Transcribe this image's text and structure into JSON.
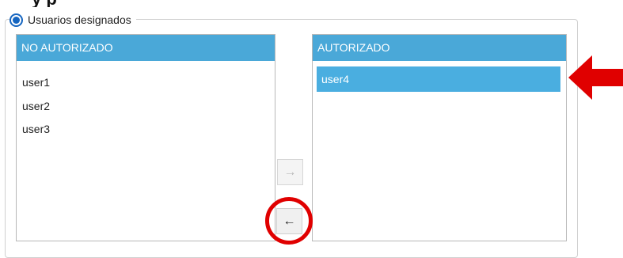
{
  "top_text": "y                         p",
  "group": {
    "radio_label": "Usuarios designados"
  },
  "lists": {
    "left": {
      "header": "NO AUTORIZADO",
      "items": [
        "user1",
        "user2",
        "user3"
      ]
    },
    "right": {
      "header": "AUTORIZADO",
      "items": [
        "user4"
      ],
      "selected_index": 0
    }
  },
  "buttons": {
    "move_right": "→",
    "move_left": "←"
  },
  "colors": {
    "header_blue": "#4aa8d8",
    "selected_blue": "#4aaee0",
    "annotation_red": "#e00000",
    "radio_blue": "#1565c0"
  }
}
